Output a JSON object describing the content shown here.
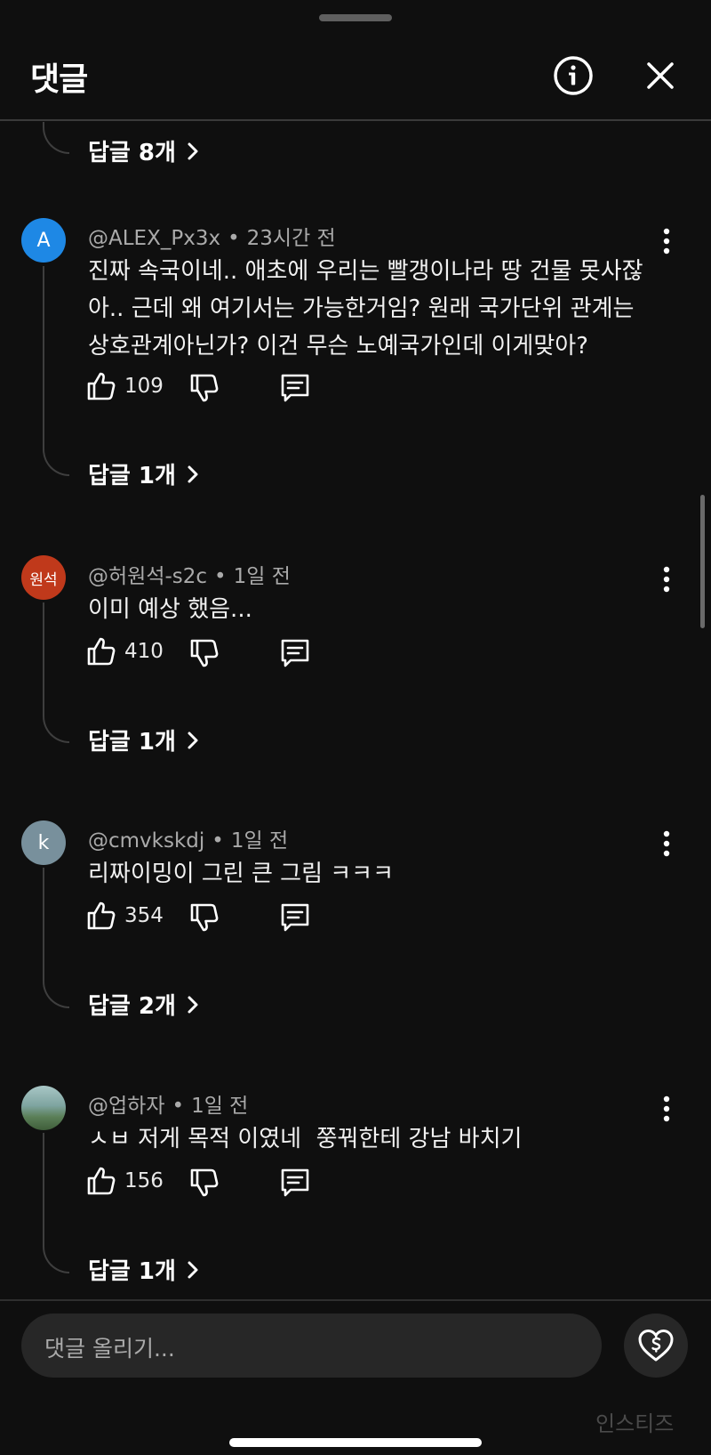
{
  "header": {
    "title": "댓글"
  },
  "top_replies": {
    "label": "답글 8개"
  },
  "comments": [
    {
      "author": "@ALEX_Px3x",
      "time": "23시간 전",
      "avatar_text": "A",
      "avatar_color": "#1e88e5",
      "text_lines": [
        "진짜 속국이네.. 애초에 우리는 빨갱이나라 땅 건물 못사잖",
        "아.. 근데 왜 여기서는 가능한거임? 원래 국가단위 관계는",
        "상호관계아닌가? 이건 무슨 노예국가인데 이게맞아?"
      ],
      "likes": "109",
      "replies_label": "답글 1개"
    },
    {
      "author": "@허원석-s2c",
      "time": "1일 전",
      "avatar_text": "원석",
      "avatar_color": "#c0391b",
      "text_lines": [
        "이미 예상 했음..."
      ],
      "likes": "410",
      "replies_label": "답글 1개"
    },
    {
      "author": "@cmvkskdj",
      "time": "1일 전",
      "avatar_text": "k",
      "avatar_color": "#78909c",
      "text_lines": [
        "리짜이밍이 그린 큰 그림 ㅋㅋㅋ"
      ],
      "likes": "354",
      "replies_label": "답글 2개"
    },
    {
      "author": "@업하자",
      "time": "1일 전",
      "avatar_text": "",
      "avatar_color": "#6f8f8a",
      "text_lines": [
        "ㅅㅂ 저게 목적 이였네  쭝꿔한테 강남 바치기"
      ],
      "likes": "156",
      "replies_label": "답글 1개"
    }
  ],
  "composer": {
    "placeholder": "댓글 올리기..."
  },
  "watermark": "인스티즈",
  "icons": {
    "info": "info-circle-icon",
    "close": "close-icon",
    "like": "thumbs-up-icon",
    "dislike": "thumbs-down-icon",
    "reply": "comment-bubble-icon",
    "more": "more-vert-icon",
    "thanks": "heart-dollar-icon"
  }
}
